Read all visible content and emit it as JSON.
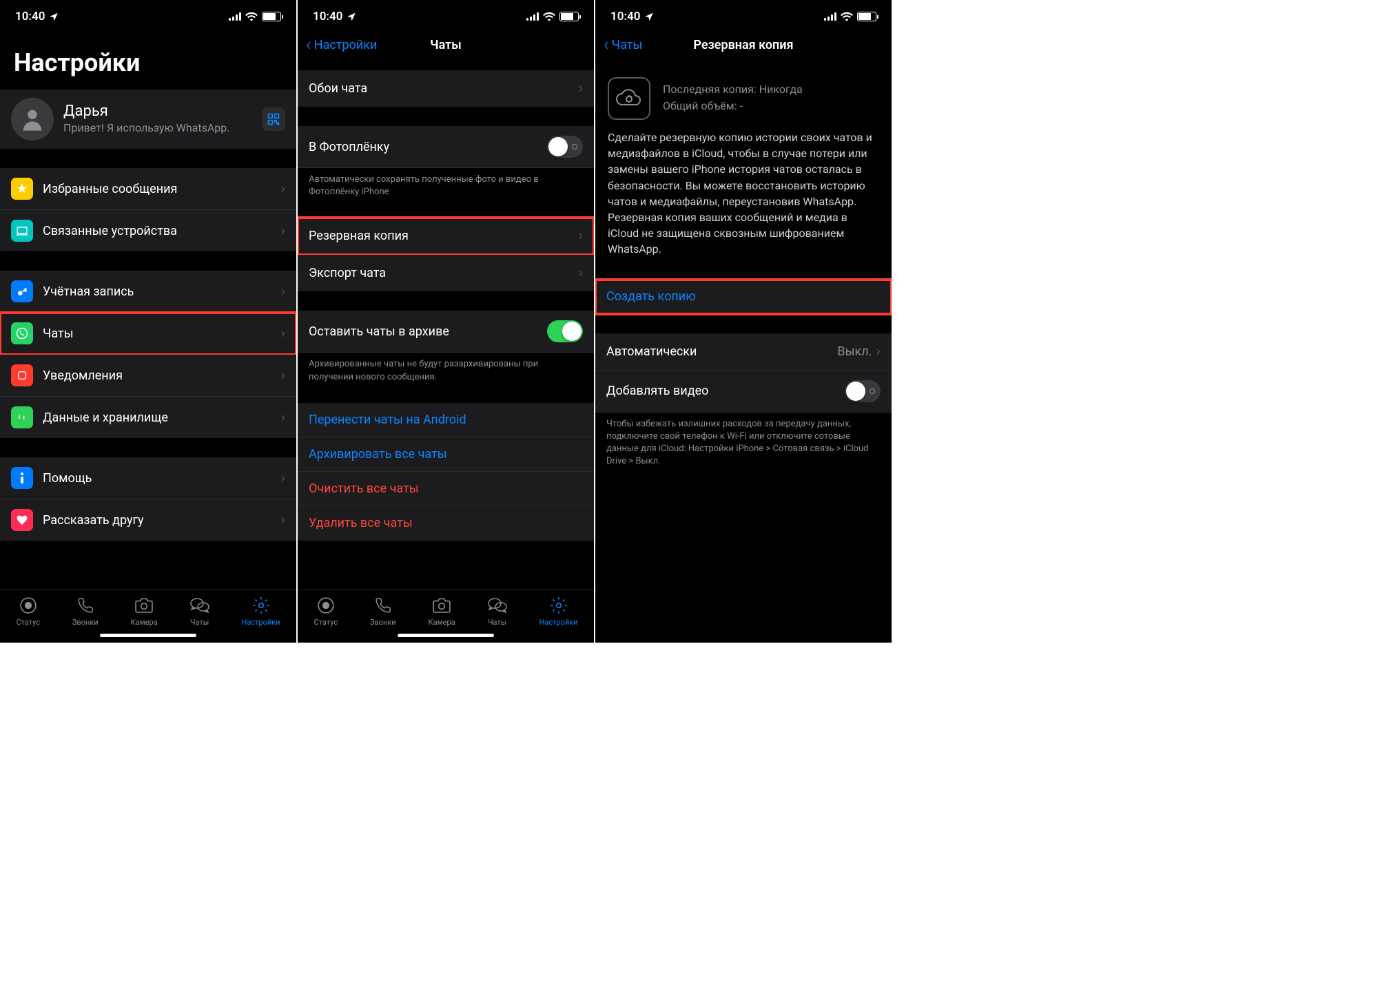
{
  "status": {
    "time": "10:40"
  },
  "tabs": {
    "status": "Статус",
    "calls": "Звонки",
    "camera": "Камера",
    "chats": "Чаты",
    "settings": "Настройки"
  },
  "screen1": {
    "title": "Настройки",
    "profile": {
      "name": "Дарья",
      "status": "Привет! Я использую WhatsApp."
    },
    "rows": {
      "starred": "Избранные сообщения",
      "linked": "Связанные устройства",
      "account": "Учётная запись",
      "chats": "Чаты",
      "notifications": "Уведомления",
      "storage": "Данные и хранилище",
      "help": "Помощь",
      "tell": "Рассказать другу"
    }
  },
  "screen2": {
    "back": "Настройки",
    "title": "Чаты",
    "rows": {
      "wallpaper": "Обои чата",
      "camera_roll": "В Фотоплёнку",
      "camera_roll_footer": "Автоматически сохранять полученные фото и видео в Фотоплёнку iPhone",
      "backup": "Резервная копия",
      "export": "Экспорт чата",
      "keep_archived": "Оставить чаты в архиве",
      "keep_archived_footer": "Архивированные чаты не будут разархивированы при получении нового сообщения.",
      "transfer": "Перенести чаты на Android",
      "archive_all": "Архивировать все чаты",
      "clear_all": "Очистить все чаты",
      "delete_all": "Удалить все чаты"
    }
  },
  "screen3": {
    "back": "Чаты",
    "title": "Резервная копия",
    "last_label": "Последняя копия: Никогда",
    "size_label": "Общий объём: -",
    "desc": "Сделайте резервную копию истории своих чатов и медиафайлов в iCloud, чтобы в случае потери или замены вашего iPhone история чатов осталась в безопасности. Вы можете восстановить историю чатов и медиафайлы, переустановив WhatsApp. Резервная копия ваших сообщений и медиа в iCloud не защищена сквозным шифрованием WhatsApp.",
    "create": "Создать копию",
    "auto_label": "Автоматически",
    "auto_value": "Выкл.",
    "video": "Добавлять видео",
    "video_footer": "Чтобы избежать излишних расходов за передачу данных, подключите свой телефон к Wi-Fi или отключите сотовые данные для iCloud: Настройки iPhone > Сотовая связь > iCloud Drive > Выкл."
  }
}
